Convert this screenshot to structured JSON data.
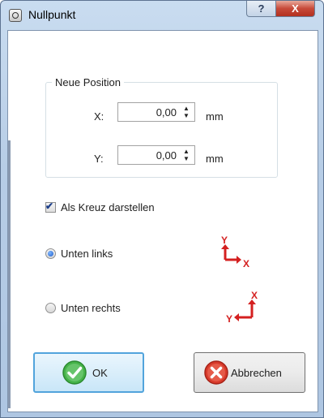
{
  "window": {
    "title": "Nullpunkt",
    "help_label": "?",
    "close_label": "X"
  },
  "group": {
    "title": "Neue Position",
    "x_label": "X:",
    "x_value": "0,00",
    "x_unit": "mm",
    "y_label": "Y:",
    "y_value": "0,00",
    "y_unit": "mm"
  },
  "options": {
    "show_cross_label": "Als Kreuz darstellen",
    "show_cross_checked": true,
    "bottom_left_label": "Unten links",
    "bottom_left_selected": true,
    "bottom_right_label": "Unten rechts",
    "bottom_right_selected": false
  },
  "axis_icons": {
    "bottom_left": {
      "y": "Y",
      "x": "X"
    },
    "bottom_right": {
      "y": "Y",
      "x": "X"
    },
    "color": "#d42020"
  },
  "buttons": {
    "ok_label": "OK",
    "cancel_label": "Abbrechen"
  },
  "colors": {
    "ok_icon": "#3fae3f",
    "cancel_icon": "#d83a2b",
    "focus_border": "#52a4dc"
  }
}
